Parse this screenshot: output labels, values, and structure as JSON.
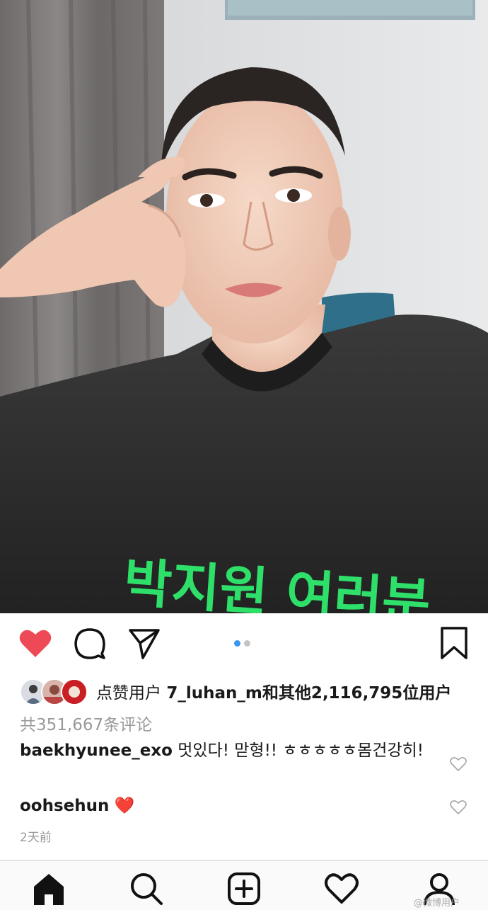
{
  "post": {
    "carousel": {
      "count": 2,
      "active_index": 0
    },
    "tshirt_text": "박지원 여러분"
  },
  "actions": {
    "like_icon": "heart-filled-icon",
    "comment_icon": "comment-bubble-icon",
    "share_icon": "paper-plane-icon",
    "save_icon": "bookmark-icon",
    "like_color": "#ed4956"
  },
  "likes": {
    "prefix": "点赞用户 ",
    "user": "7_luhan_m",
    "connector": "和其他",
    "count": "2,116,795",
    "suffix": "位用户"
  },
  "comments_summary": "共351,667条评论",
  "comments": [
    {
      "user": "baekhyunee_exo",
      "text": " 멋있다! 맏형!! ㅎㅎㅎㅎㅎ몸건강히!"
    },
    {
      "user": "oohsehun",
      "text": " ❤️"
    }
  ],
  "timestamp": "2天前",
  "bottom_nav": {
    "items": [
      "home-icon",
      "search-icon",
      "add-post-icon",
      "activity-heart-icon",
      "profile-icon"
    ],
    "active": "home-icon"
  },
  "watermark": "@微博用户"
}
